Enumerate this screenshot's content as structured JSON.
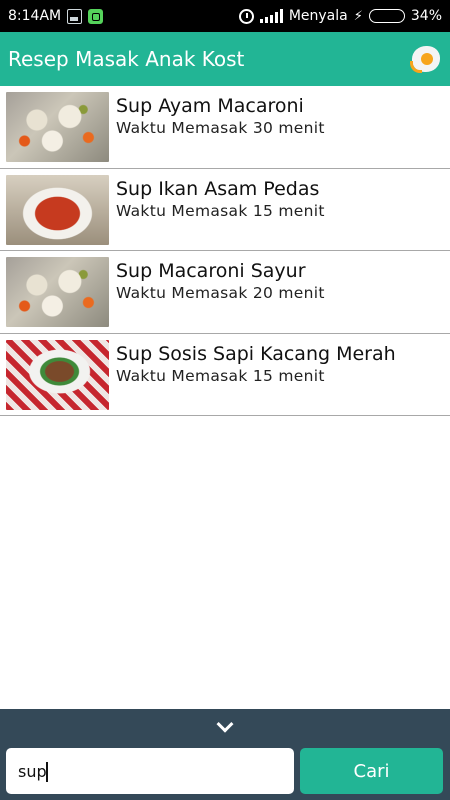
{
  "status_bar": {
    "time": "8:14AM",
    "carrier": "Menyala",
    "battery": "34%",
    "battery_level": 0.34
  },
  "app_bar": {
    "title": "Resep Masak Anak Kost",
    "logo_icon": "fried-egg-icon"
  },
  "recipes": [
    {
      "title": "Sup Ayam Macaroni",
      "subtitle": "Waktu Memasak 30 menit",
      "thumb": "soup-a"
    },
    {
      "title": "Sup Ikan Asam Pedas",
      "subtitle": "Waktu Memasak 15 menit",
      "thumb": "fish"
    },
    {
      "title": "Sup Macaroni Sayur",
      "subtitle": "Waktu Memasak 20 menit",
      "thumb": "soup-a"
    },
    {
      "title": "Sup Sosis Sapi Kacang Merah",
      "subtitle": "Waktu Memasak 15 menit",
      "thumb": "sosis"
    }
  ],
  "search": {
    "value": "sup",
    "button_label": "Cari"
  },
  "colors": {
    "primary": "#22b595",
    "bottom_panel": "#344958"
  }
}
